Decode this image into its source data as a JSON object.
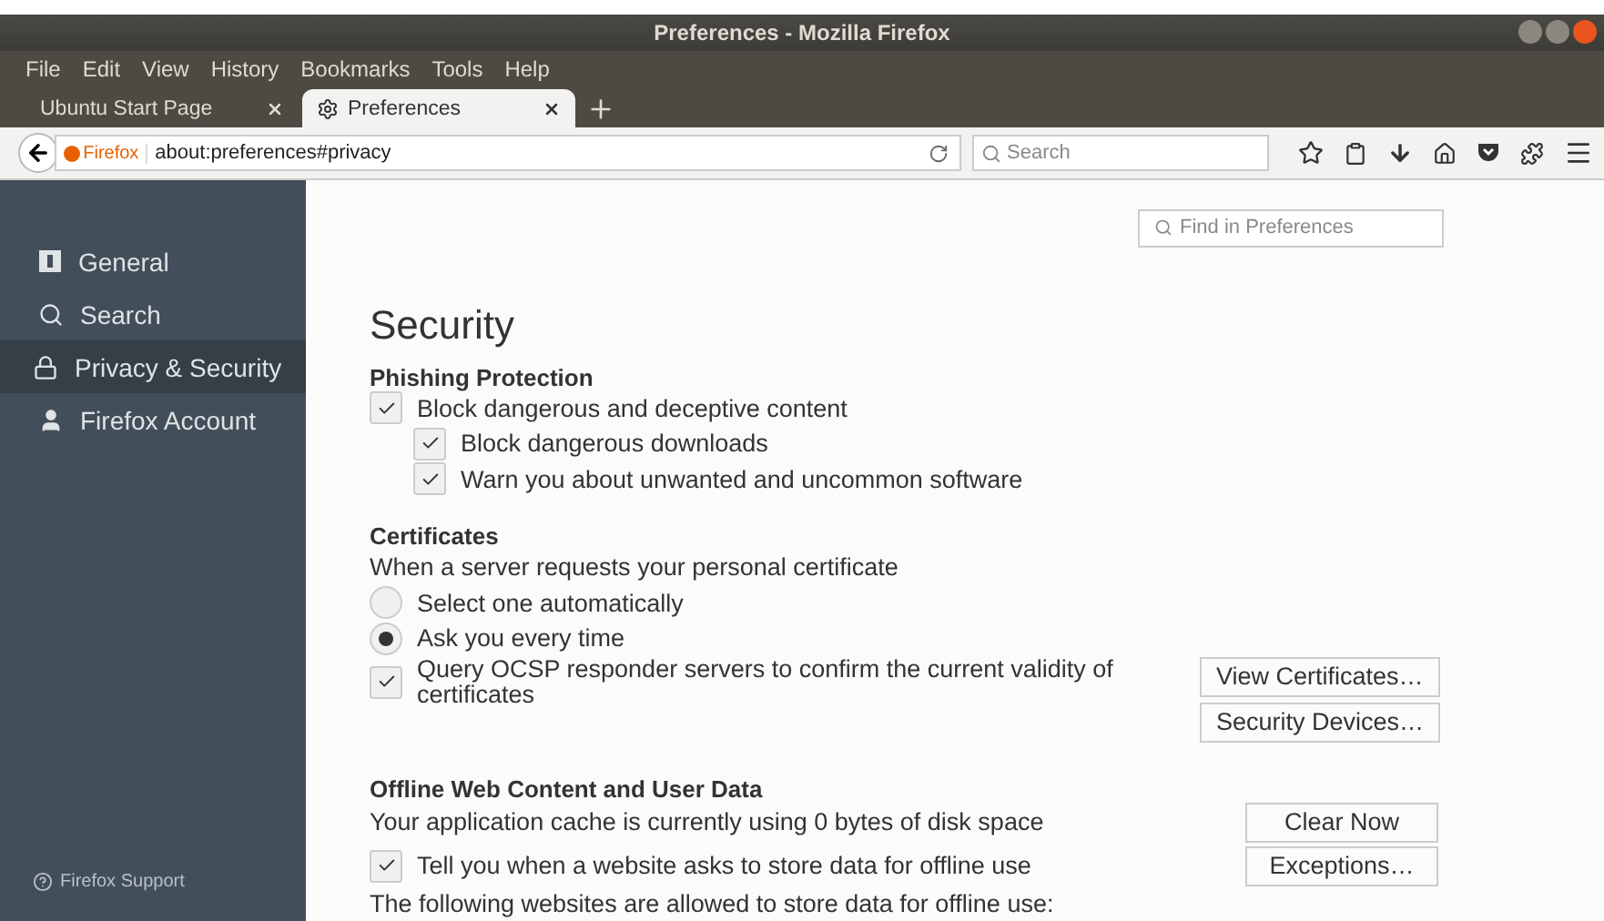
{
  "window": {
    "title": "Preferences - Mozilla Firefox"
  },
  "menu": [
    "File",
    "Edit",
    "View",
    "History",
    "Bookmarks",
    "Tools",
    "Help"
  ],
  "tabs": [
    {
      "label": "Ubuntu Start Page",
      "selected": false,
      "kind": "plain"
    },
    {
      "label": "Preferences",
      "selected": true,
      "kind": "settings"
    }
  ],
  "navbar": {
    "identity": "Firefox",
    "url": "about:preferences#privacy",
    "search_placeholder": "Search"
  },
  "sidebar": {
    "items": [
      {
        "label": "General",
        "selected": false,
        "kind": "general"
      },
      {
        "label": "Search",
        "selected": false,
        "kind": "search"
      },
      {
        "label": "Privacy & Security",
        "selected": true,
        "kind": "privacy"
      },
      {
        "label": "Firefox Account",
        "selected": false,
        "kind": "account"
      }
    ],
    "support": "Firefox Support"
  },
  "find": {
    "placeholder": "Find in Preferences"
  },
  "title": "Security",
  "phishing": {
    "heading": "Phishing Protection",
    "options": [
      {
        "label": "Block dangerous and deceptive content",
        "checked": true,
        "children": [
          {
            "label": "Block dangerous downloads",
            "checked": true
          },
          {
            "label": "Warn you about unwanted and uncommon software",
            "checked": true
          }
        ]
      }
    ]
  },
  "certificates": {
    "heading": "Certificates",
    "prompt": "When a server requests your personal certificate",
    "choices": [
      {
        "label": "Select one automatically",
        "selected": false
      },
      {
        "label": "Ask you every time",
        "selected": true
      }
    ],
    "ocsp": {
      "label": "Query OCSP responder servers to confirm the current validity of certificates",
      "checked": true
    },
    "buttons": [
      "View Certificates…",
      "Security Devices…"
    ]
  },
  "offline": {
    "heading": "Offline Web Content and User Data",
    "usage": "Your application cache is currently using 0 bytes of disk space",
    "clear_button": "Clear Now",
    "notify": {
      "label": "Tell you when a website asks to store data for offline use",
      "checked": true
    },
    "exceptions_button": "Exceptions…",
    "note": "The following websites are allowed to store data for offline use:"
  }
}
